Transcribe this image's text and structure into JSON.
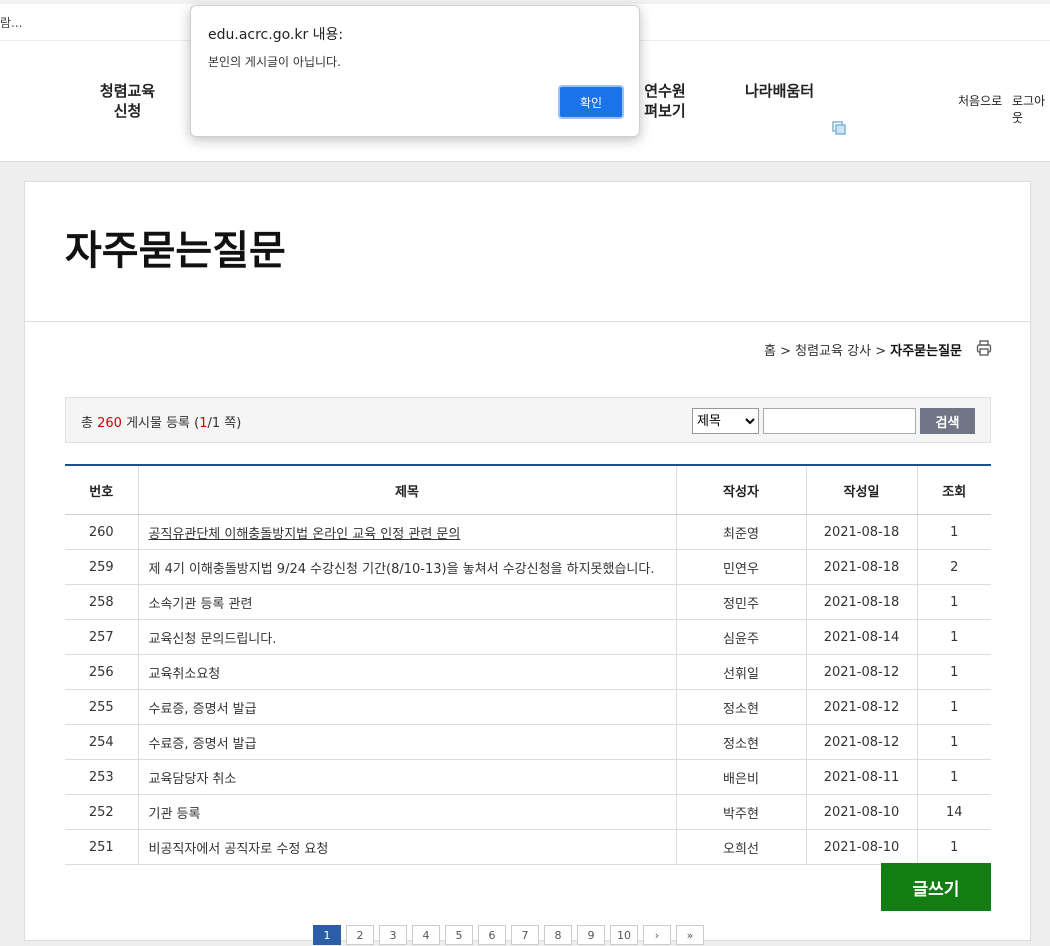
{
  "loading": {
    "text": "람..."
  },
  "nav": {
    "menu1": "청렴교육\n신청",
    "menu2": "연수원\n펴보기",
    "menu3": "나라배움터",
    "util_home": "처음으로",
    "util_login": "로그아웃"
  },
  "alert": {
    "host": "edu.acrc.go.kr 내용:",
    "message": "본인의 게시글이 아닙니다.",
    "ok": "확인"
  },
  "page": {
    "title": "자주묻는질문",
    "breadcrumb": [
      "홈",
      "청렴교육 강사",
      "자주묻는질문"
    ]
  },
  "search": {
    "count_prefix": "총",
    "total": "260",
    "count_mid": "게시물 등록 (",
    "page": "1",
    "count_suffix": "/1 쪽)",
    "field_selected": "제목",
    "query": "",
    "button": "검색"
  },
  "table": {
    "headers": [
      "번호",
      "제목",
      "작성자",
      "작성일",
      "조회"
    ],
    "rows": [
      [
        "260",
        "공직유관단체 이해충돌방지법 온라인 교육 인정 관련 문의",
        "최준영",
        "2021-08-18",
        "1"
      ],
      [
        "259",
        "제 4기 이해충돌방지법 9/24 수강신청 기간(8/10-13)을 놓쳐서 수강신청을 하지못했습니다.",
        "민연우",
        "2021-08-18",
        "2"
      ],
      [
        "258",
        "소속기관 등록 관련",
        "정민주",
        "2021-08-18",
        "1"
      ],
      [
        "257",
        "교육신청 문의드립니다.",
        "심윤주",
        "2021-08-14",
        "1"
      ],
      [
        "256",
        "교육취소요청",
        "선휘일",
        "2021-08-12",
        "1"
      ],
      [
        "255",
        "수료증, 증명서 발급",
        "정소현",
        "2021-08-12",
        "1"
      ],
      [
        "254",
        "수료증, 증명서 발급",
        "정소현",
        "2021-08-12",
        "1"
      ],
      [
        "253",
        "교육담당자 취소",
        "배은비",
        "2021-08-11",
        "1"
      ],
      [
        "252",
        "기관 등록",
        "박주현",
        "2021-08-10",
        "14"
      ],
      [
        "251",
        "비공직자에서 공직자로 수정 요청",
        "오희선",
        "2021-08-10",
        "1"
      ]
    ]
  },
  "write_button": "글쓰기",
  "pager": [
    "1",
    "2",
    "3",
    "4",
    "5",
    "6",
    "7",
    "8",
    "9",
    "10",
    "›",
    "»"
  ],
  "colors": {
    "accent": "#1a73e8",
    "table_top": "#1f4e8c",
    "write": "#127d12",
    "highlight": "#d40000"
  }
}
